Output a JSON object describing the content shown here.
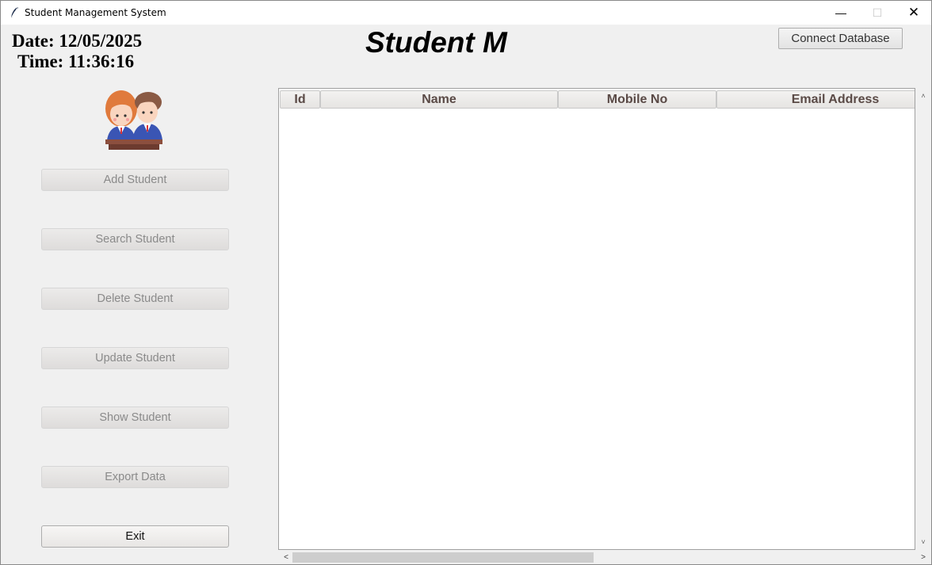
{
  "window": {
    "title": "Student Management System",
    "controls": {
      "minimize": "—",
      "maximize": "☐",
      "close": "✕"
    }
  },
  "clock": {
    "date": "Date: 12/05/2025",
    "time": "Time: 11:36:16"
  },
  "heading": "Student M",
  "connect_button": "Connect Database",
  "image": {
    "icon": "students-illustration"
  },
  "sidebar": {
    "buttons": [
      {
        "label": "Add Student",
        "enabled": false
      },
      {
        "label": "Search Student",
        "enabled": false
      },
      {
        "label": "Delete Student",
        "enabled": false
      },
      {
        "label": "Update Student",
        "enabled": false
      },
      {
        "label": "Show Student",
        "enabled": false
      },
      {
        "label": "Export Data",
        "enabled": false
      },
      {
        "label": "Exit",
        "enabled": true
      }
    ]
  },
  "table": {
    "columns": [
      "Id",
      "Name",
      "Mobile No",
      "Email Address"
    ],
    "rows": []
  },
  "scroll": {
    "up": "˄",
    "down": "˅",
    "left": "<",
    "right": ">"
  },
  "colors": {
    "window_bg": "#f0f0f0",
    "header_text": "#5a4a46",
    "disabled_text": "#8a8a8a"
  }
}
